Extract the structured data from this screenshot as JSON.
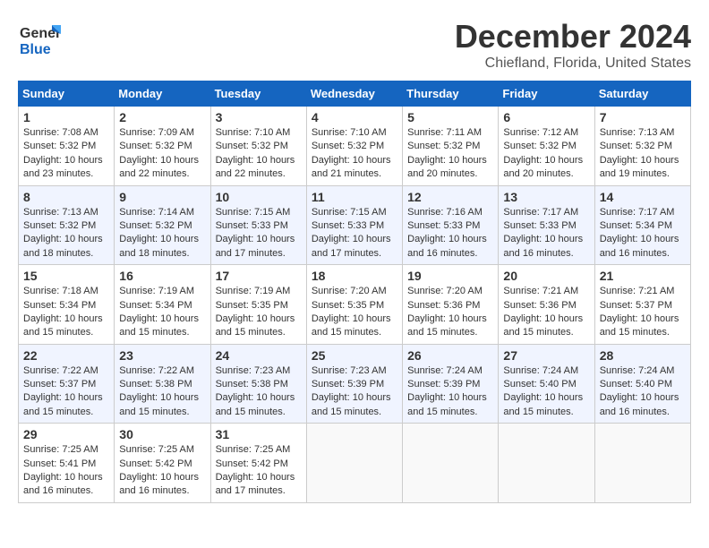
{
  "logo": {
    "line1": "General",
    "line2": "Blue"
  },
  "title": "December 2024",
  "location": "Chiefland, Florida, United States",
  "headers": [
    "Sunday",
    "Monday",
    "Tuesday",
    "Wednesday",
    "Thursday",
    "Friday",
    "Saturday"
  ],
  "weeks": [
    [
      {
        "day": "1",
        "sunrise": "7:08 AM",
        "sunset": "5:32 PM",
        "daylight": "10 hours and 23 minutes."
      },
      {
        "day": "2",
        "sunrise": "7:09 AM",
        "sunset": "5:32 PM",
        "daylight": "10 hours and 22 minutes."
      },
      {
        "day": "3",
        "sunrise": "7:10 AM",
        "sunset": "5:32 PM",
        "daylight": "10 hours and 22 minutes."
      },
      {
        "day": "4",
        "sunrise": "7:10 AM",
        "sunset": "5:32 PM",
        "daylight": "10 hours and 21 minutes."
      },
      {
        "day": "5",
        "sunrise": "7:11 AM",
        "sunset": "5:32 PM",
        "daylight": "10 hours and 20 minutes."
      },
      {
        "day": "6",
        "sunrise": "7:12 AM",
        "sunset": "5:32 PM",
        "daylight": "10 hours and 20 minutes."
      },
      {
        "day": "7",
        "sunrise": "7:13 AM",
        "sunset": "5:32 PM",
        "daylight": "10 hours and 19 minutes."
      }
    ],
    [
      {
        "day": "8",
        "sunrise": "7:13 AM",
        "sunset": "5:32 PM",
        "daylight": "10 hours and 18 minutes."
      },
      {
        "day": "9",
        "sunrise": "7:14 AM",
        "sunset": "5:32 PM",
        "daylight": "10 hours and 18 minutes."
      },
      {
        "day": "10",
        "sunrise": "7:15 AM",
        "sunset": "5:33 PM",
        "daylight": "10 hours and 17 minutes."
      },
      {
        "day": "11",
        "sunrise": "7:15 AM",
        "sunset": "5:33 PM",
        "daylight": "10 hours and 17 minutes."
      },
      {
        "day": "12",
        "sunrise": "7:16 AM",
        "sunset": "5:33 PM",
        "daylight": "10 hours and 16 minutes."
      },
      {
        "day": "13",
        "sunrise": "7:17 AM",
        "sunset": "5:33 PM",
        "daylight": "10 hours and 16 minutes."
      },
      {
        "day": "14",
        "sunrise": "7:17 AM",
        "sunset": "5:34 PM",
        "daylight": "10 hours and 16 minutes."
      }
    ],
    [
      {
        "day": "15",
        "sunrise": "7:18 AM",
        "sunset": "5:34 PM",
        "daylight": "10 hours and 15 minutes."
      },
      {
        "day": "16",
        "sunrise": "7:19 AM",
        "sunset": "5:34 PM",
        "daylight": "10 hours and 15 minutes."
      },
      {
        "day": "17",
        "sunrise": "7:19 AM",
        "sunset": "5:35 PM",
        "daylight": "10 hours and 15 minutes."
      },
      {
        "day": "18",
        "sunrise": "7:20 AM",
        "sunset": "5:35 PM",
        "daylight": "10 hours and 15 minutes."
      },
      {
        "day": "19",
        "sunrise": "7:20 AM",
        "sunset": "5:36 PM",
        "daylight": "10 hours and 15 minutes."
      },
      {
        "day": "20",
        "sunrise": "7:21 AM",
        "sunset": "5:36 PM",
        "daylight": "10 hours and 15 minutes."
      },
      {
        "day": "21",
        "sunrise": "7:21 AM",
        "sunset": "5:37 PM",
        "daylight": "10 hours and 15 minutes."
      }
    ],
    [
      {
        "day": "22",
        "sunrise": "7:22 AM",
        "sunset": "5:37 PM",
        "daylight": "10 hours and 15 minutes."
      },
      {
        "day": "23",
        "sunrise": "7:22 AM",
        "sunset": "5:38 PM",
        "daylight": "10 hours and 15 minutes."
      },
      {
        "day": "24",
        "sunrise": "7:23 AM",
        "sunset": "5:38 PM",
        "daylight": "10 hours and 15 minutes."
      },
      {
        "day": "25",
        "sunrise": "7:23 AM",
        "sunset": "5:39 PM",
        "daylight": "10 hours and 15 minutes."
      },
      {
        "day": "26",
        "sunrise": "7:24 AM",
        "sunset": "5:39 PM",
        "daylight": "10 hours and 15 minutes."
      },
      {
        "day": "27",
        "sunrise": "7:24 AM",
        "sunset": "5:40 PM",
        "daylight": "10 hours and 15 minutes."
      },
      {
        "day": "28",
        "sunrise": "7:24 AM",
        "sunset": "5:40 PM",
        "daylight": "10 hours and 16 minutes."
      }
    ],
    [
      {
        "day": "29",
        "sunrise": "7:25 AM",
        "sunset": "5:41 PM",
        "daylight": "10 hours and 16 minutes."
      },
      {
        "day": "30",
        "sunrise": "7:25 AM",
        "sunset": "5:42 PM",
        "daylight": "10 hours and 16 minutes."
      },
      {
        "day": "31",
        "sunrise": "7:25 AM",
        "sunset": "5:42 PM",
        "daylight": "10 hours and 17 minutes."
      },
      null,
      null,
      null,
      null
    ]
  ],
  "labels": {
    "sunrise": "Sunrise:",
    "sunset": "Sunset:",
    "daylight": "Daylight:"
  }
}
